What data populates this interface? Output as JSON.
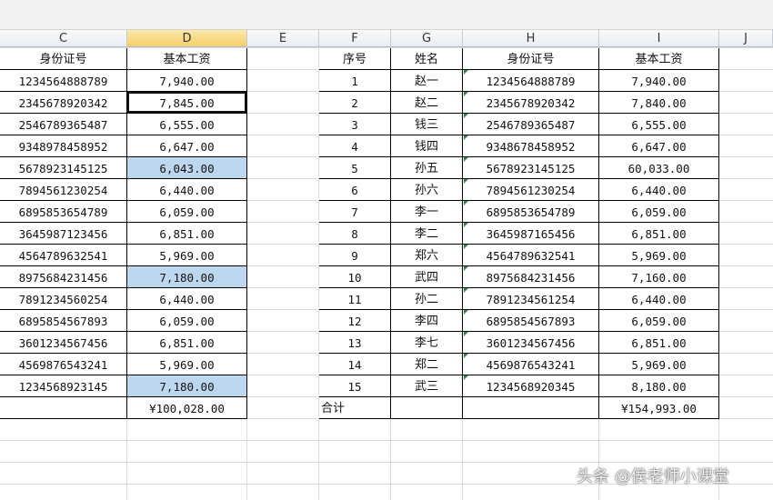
{
  "columns": [
    {
      "id": "C",
      "label": "C"
    },
    {
      "id": "D",
      "label": "D"
    },
    {
      "id": "E",
      "label": "E"
    },
    {
      "id": "F",
      "label": "F"
    },
    {
      "id": "G",
      "label": "G"
    },
    {
      "id": "H",
      "label": "H"
    },
    {
      "id": "I",
      "label": "I"
    },
    {
      "id": "J",
      "label": "J"
    }
  ],
  "left_table": {
    "headers": {
      "id": "身份证号",
      "salary": "基本工资"
    },
    "rows": [
      {
        "id": "1234564888789",
        "salary": "7,940.00"
      },
      {
        "id": "2345678920342",
        "salary": "7,845.00"
      },
      {
        "id": "2546789365487",
        "salary": "6,555.00"
      },
      {
        "id": "9348978458952",
        "salary": "6,647.00"
      },
      {
        "id": "5678923145125",
        "salary": "6,043.00"
      },
      {
        "id": "7894561230254",
        "salary": "6,440.00"
      },
      {
        "id": "6895853654789",
        "salary": "6,059.00"
      },
      {
        "id": "3645987123456",
        "salary": "6,851.00"
      },
      {
        "id": "4564789632541",
        "salary": "5,969.00"
      },
      {
        "id": "8975684231456",
        "salary": "7,180.00"
      },
      {
        "id": "7891234560254",
        "salary": "6,440.00"
      },
      {
        "id": "6895854567893",
        "salary": "6,059.00"
      },
      {
        "id": "3601234567456",
        "salary": "6,851.00"
      },
      {
        "id": "4569876543241",
        "salary": "5,969.00"
      },
      {
        "id": "1234568923145",
        "salary": "7,180.00"
      }
    ],
    "total": "¥100,028.00"
  },
  "right_table": {
    "headers": {
      "no": "序号",
      "name": "姓名",
      "id": "身份证号",
      "salary": "基本工资"
    },
    "rows": [
      {
        "no": "1",
        "name": "赵一",
        "id": "1234564888789",
        "salary": "7,940.00"
      },
      {
        "no": "2",
        "name": "赵二",
        "id": "2345678920342",
        "salary": "7,840.00"
      },
      {
        "no": "3",
        "name": "钱三",
        "id": "2546789365487",
        "salary": "6,555.00"
      },
      {
        "no": "4",
        "name": "钱四",
        "id": "9348678458952",
        "salary": "6,647.00"
      },
      {
        "no": "5",
        "name": "孙五",
        "id": "5678923145125",
        "salary": "60,033.00"
      },
      {
        "no": "6",
        "name": "孙六",
        "id": "7894561230254",
        "salary": "6,440.00"
      },
      {
        "no": "7",
        "name": "李一",
        "id": "6895853654789",
        "salary": "6,059.00"
      },
      {
        "no": "8",
        "name": "李二",
        "id": "3645987165456",
        "salary": "6,851.00"
      },
      {
        "no": "9",
        "name": "郑六",
        "id": "4564789632541",
        "salary": "5,969.00"
      },
      {
        "no": "10",
        "name": "武四",
        "id": "8975684231456",
        "salary": "7,160.00"
      },
      {
        "no": "11",
        "name": "孙二",
        "id": "7891234561254",
        "salary": "6,440.00"
      },
      {
        "no": "12",
        "name": "李四",
        "id": "6895854567893",
        "salary": "6,059.00"
      },
      {
        "no": "13",
        "name": "李七",
        "id": "3601234567456",
        "salary": "6,851.00"
      },
      {
        "no": "14",
        "name": "郑二",
        "id": "4569876543241",
        "salary": "5,969.00"
      },
      {
        "no": "15",
        "name": "武三",
        "id": "1234568920345",
        "salary": "8,180.00"
      }
    ],
    "total_label": "合计",
    "total": "¥154,993.00"
  },
  "highlighted_left_rows": [
    4,
    9,
    14
  ],
  "selected_left_row": 1,
  "highlight_color": "#bdd7ee",
  "watermark": "头条 @侯老师小课堂"
}
